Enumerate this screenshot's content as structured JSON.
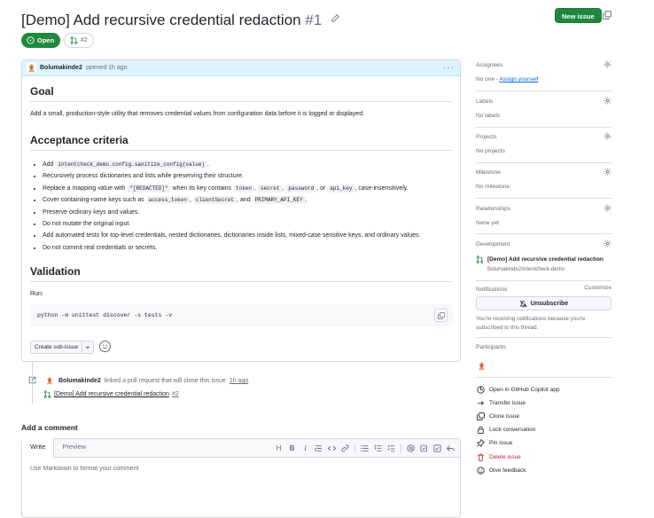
{
  "header": {
    "title": "[Demo] Add recursive credential redaction",
    "number": "#1",
    "new_issue_label": "New issue",
    "state_label": "Open",
    "linked_pr": "#2"
  },
  "comment": {
    "author": "Bolumakinde2",
    "meta": "opened 1h ago",
    "goal_heading": "Goal",
    "goal_text": "Add a small, production-style utility that removes credential values from configuration data before it is logged or displayed.",
    "criteria_heading": "Acceptance criteria",
    "criteria": [
      {
        "pre": "Add ",
        "code": [
          "intentcheck_demo.config.sanitize_config(value)"
        ],
        "post": "."
      },
      {
        "pre": "Recursively process dictionaries and lists while preserving their structure."
      },
      {
        "pre": "Replace a mapping value with ",
        "code": [
          "\"[REDACTED]\""
        ],
        "mid": " when its key contains ",
        "code2": [
          "token",
          "secret",
          "password"
        ],
        "post": ", or ",
        "code3": "api_key",
        "tail": ", case-insensitively."
      },
      {
        "pre": "Cover containing-name keys such as ",
        "code": [
          "access_token",
          "clientSecret"
        ],
        "post": ", and ",
        "code3": "PRIMARY_API_KEY",
        "tail": "."
      },
      {
        "pre": "Preserve ordinary keys and values."
      },
      {
        "pre": "Do not mutate the original input."
      },
      {
        "pre": "Add automated tests for top-level credentials, nested dictionaries, dictionaries inside lists, mixed-case sensitive keys, and ordinary values."
      },
      {
        "pre": "Do not commit real credentials or secrets."
      }
    ],
    "validation_heading": "Validation",
    "run_label": "Run:",
    "command": "python -m unittest discover -s tests -v",
    "create_subissue_label": "Create sub-issue"
  },
  "timeline": {
    "author": "Bolumakinde2",
    "text": "linked a pull request that will close this issue",
    "ago": "1h ago",
    "pr_title": "[Demo] Add recursive credential redaction",
    "pr_number": "#2"
  },
  "add_comment": {
    "title": "Add a comment",
    "tab_write": "Write",
    "tab_preview": "Preview",
    "placeholder": "Use Markdown to format your comment",
    "toolbar_heading": "H",
    "toolbar_bold": "B",
    "toolbar_italic": "I"
  },
  "sidebar": {
    "assignees_title": "Assignees",
    "assignees_value": "No one - ",
    "assign_yourself": "Assign yourself",
    "labels_title": "Labels",
    "labels_value": "No labels",
    "projects_title": "Projects",
    "projects_value": "No projects",
    "milestone_title": "Milestone",
    "milestone_value": "No milestone",
    "relationships_title": "Relationships",
    "relationships_value": "None yet",
    "development_title": "Development",
    "dev_pr_title": "[Demo] Add recursive credential redaction",
    "dev_pr_repo": "Bolumakinde2/intentcheck-demo",
    "notifications_title": "Notifications",
    "customize_label": "Customize",
    "unsubscribe_label": "Unsubscribe",
    "notif_text": "You're receiving notifications because you're subscribed to this thread.",
    "participants_title": "Participants",
    "actions": [
      {
        "icon": "copilot-icon",
        "label": "Open in GitHub Copilot app"
      },
      {
        "icon": "arrow-right-icon",
        "label": "Transfer issue"
      },
      {
        "icon": "clone-icon",
        "label": "Clone issue"
      },
      {
        "icon": "lock-icon",
        "label": "Lock conversation"
      },
      {
        "icon": "pin-icon",
        "label": "Pin issue"
      },
      {
        "icon": "trash-icon",
        "label": "Delete issue"
      },
      {
        "icon": "smiley-icon",
        "label": "Give feedback"
      }
    ]
  },
  "colors": {
    "green": "#1f883d",
    "blue_header": "#ddf4ff",
    "link": "#0969da",
    "danger": "#cf222e",
    "muted": "#656d76"
  }
}
